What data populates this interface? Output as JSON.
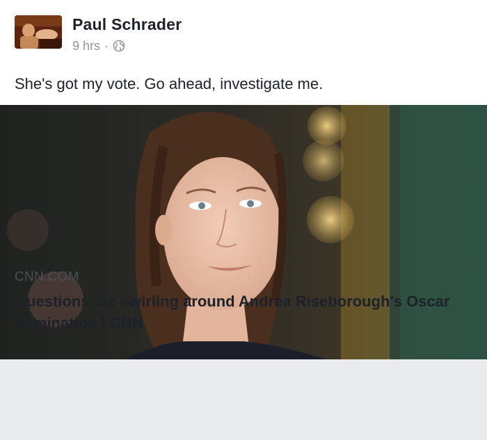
{
  "post": {
    "author": "Paul Schrader",
    "time": "9 hrs",
    "separator": "·",
    "privacy_icon": "globe-icon",
    "text": "She's got my vote. Go ahead, investigate me."
  },
  "link": {
    "domain": "CNN.COM",
    "title": "Questions are swirling around Andrea Riseborough's Oscar nomination | CNN",
    "image": "photo of a woman with long brown hair at an event"
  },
  "colors": {
    "text_primary": "#1d2129",
    "text_secondary": "#90949c",
    "caption_bg": "#e9ebee"
  }
}
